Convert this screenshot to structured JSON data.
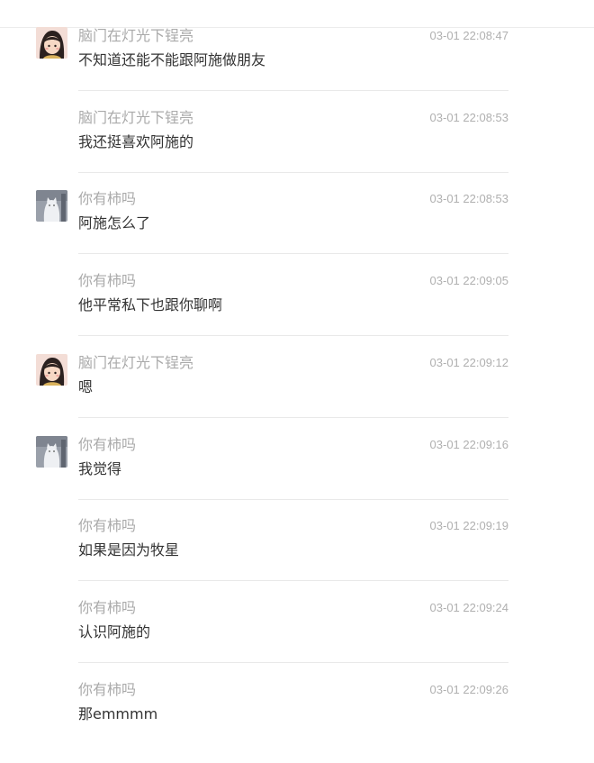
{
  "messages": [
    {
      "sender": "脑门在灯光下锃亮",
      "time": "03-01 22:08:47",
      "text": "不知道还能不能跟阿施做朋友",
      "avatar": "girl-avatar"
    },
    {
      "sender": "脑门在灯光下锃亮",
      "time": "03-01 22:08:53",
      "text": "我还挺喜欢阿施的",
      "avatar": ""
    },
    {
      "sender": "你有柿吗",
      "time": "03-01 22:08:53",
      "text": "阿施怎么了",
      "avatar": "cat-avatar"
    },
    {
      "sender": "你有柿吗",
      "time": "03-01 22:09:05",
      "text": "他平常私下也跟你聊啊",
      "avatar": ""
    },
    {
      "sender": "脑门在灯光下锃亮",
      "time": "03-01 22:09:12",
      "text": "嗯",
      "avatar": "girl-avatar"
    },
    {
      "sender": "你有柿吗",
      "time": "03-01 22:09:16",
      "text": "我觉得",
      "avatar": "cat-avatar"
    },
    {
      "sender": "你有柿吗",
      "time": "03-01 22:09:19",
      "text": "如果是因为牧星",
      "avatar": ""
    },
    {
      "sender": "你有柿吗",
      "time": "03-01 22:09:24",
      "text": "认识阿施的",
      "avatar": ""
    },
    {
      "sender": "你有柿吗",
      "time": "03-01 22:09:26",
      "text": "那emmmm",
      "avatar": ""
    }
  ],
  "colors": {
    "sender": "#aaaaaa",
    "time": "#b0b0b0",
    "text": "#333333",
    "divider": "#e9e9e9"
  }
}
